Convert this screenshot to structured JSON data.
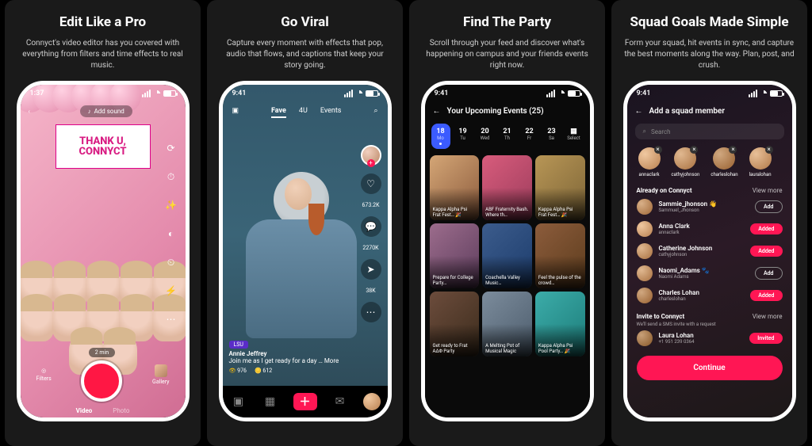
{
  "panels": [
    {
      "title": "Edit Like a Pro",
      "desc": "Connyct's video editor has you covered with everything from filters and time effects to real music."
    },
    {
      "title": "Go Viral",
      "desc": "Capture every moment with effects that pop, audio that flows, and captions that keep your story going."
    },
    {
      "title": "Find The Party",
      "desc": "Scroll through your feed and discover what's happening on campus and your friends events right now."
    },
    {
      "title": "Squad Goals Made Simple",
      "desc": "Form your squad, hit events in sync, and capture the best moments along the way. Plan, post, and crush."
    }
  ],
  "phone1": {
    "time": "1:37",
    "add_sound": "Add sound",
    "sign_l1": "THANK U,",
    "sign_l2": "CONNYCT",
    "duration": "2 min",
    "filters": "Filters",
    "gallery": "Gallery",
    "tab_video": "Video",
    "tab_photo": "Photo"
  },
  "phone2": {
    "time": "9:41",
    "tabs": {
      "fave": "Fave",
      "foru": "4U",
      "events": "Events"
    },
    "likes": "673.2K",
    "comments": "2270K",
    "shares": "38K",
    "badge": "LSU",
    "author": "Annie Jeffrey",
    "caption": "Join me as I get ready for a day … More",
    "views": "976",
    "coins": "612"
  },
  "phone3": {
    "time": "9:41",
    "header": "Your Upcoming Events (25)",
    "days": [
      {
        "n": "18",
        "w": "Mo"
      },
      {
        "n": "19",
        "w": "Tu"
      },
      {
        "n": "20",
        "w": "Wed"
      },
      {
        "n": "21",
        "w": "Th"
      },
      {
        "n": "22",
        "w": "Fr"
      },
      {
        "n": "23",
        "w": "Sa"
      }
    ],
    "select": "Select",
    "cards": [
      "Kappa Alpha Psi Frat Fest… 🎉",
      "ABF Fraternity Bash. Where th…",
      "Kappa Alpha Psi Frat Fest… 🎉",
      "Prepare for College Party…",
      "Coachella Valley Music…",
      "Feel the pulse of the crowd…",
      "Get ready to Frat AΔΦ Party",
      "A Melting Pot of Musical Magic",
      "Kappa Alpha Psi Pool Party… 🎉"
    ]
  },
  "phone4": {
    "time": "9:41",
    "header": "Add a squad member",
    "search_ph": "Search",
    "av_names": [
      "annaclark",
      "cathyjohnson",
      "charleslohan",
      "lauralohan"
    ],
    "sec1": "Already on Connyct",
    "viewmore": "View more",
    "rows1": [
      {
        "name": "Sammie_jhonson 👋",
        "handle": "Sammuel_Jhonson",
        "btn": "Add",
        "style": "add"
      },
      {
        "name": "Anna Clark",
        "handle": "annaclark",
        "btn": "Added",
        "style": "added"
      },
      {
        "name": "Catherine Johnson",
        "handle": "cathyjohnson",
        "btn": "Added",
        "style": "added"
      },
      {
        "name": "Naomi_Adams 🐾",
        "handle": "Naomi Adams",
        "btn": "Add",
        "style": "add"
      },
      {
        "name": "Charles Lohan",
        "handle": "charleslohan",
        "btn": "Added",
        "style": "added"
      }
    ],
    "sec2": "Invite to Connyct",
    "sec2_sub": "We'll send a SMS invite with a request",
    "rows2": [
      {
        "name": "Laura Lohan",
        "handle": "+1 951 239 0364",
        "btn": "Invited",
        "style": "invited"
      }
    ],
    "continue": "Continue"
  }
}
